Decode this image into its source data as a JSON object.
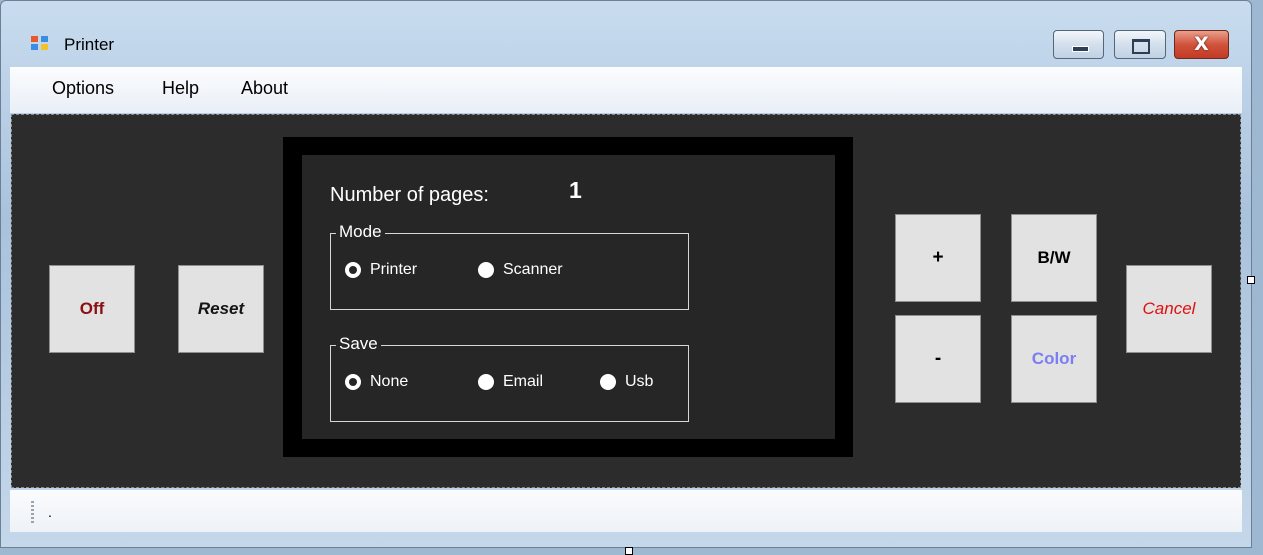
{
  "window": {
    "title": "Printer",
    "controls": {
      "minimize": "minimize",
      "maximize": "maximize",
      "close": "X"
    }
  },
  "menu": {
    "items": [
      "Options",
      "Help",
      "About"
    ]
  },
  "buttons": {
    "off": "Off",
    "reset": "Reset",
    "plus": "+",
    "minus": "-",
    "bw": "B/W",
    "color": "Color",
    "cancel": "Cancel"
  },
  "display": {
    "pages_label": "Number of pages:",
    "pages_value": "1",
    "mode": {
      "legend": "Mode",
      "options": [
        {
          "label": "Printer",
          "checked": true
        },
        {
          "label": "Scanner",
          "checked": false
        }
      ]
    },
    "save": {
      "legend": "Save",
      "options": [
        {
          "label": "None",
          "checked": true
        },
        {
          "label": "Email",
          "checked": false
        },
        {
          "label": "Usb",
          "checked": false
        }
      ]
    }
  },
  "status": {
    "text": "."
  },
  "colors": {
    "client_bg": "#2c2c2c",
    "off_text": "#8b1010",
    "color_text": "#7a7ef2",
    "cancel_text": "#e01010"
  }
}
